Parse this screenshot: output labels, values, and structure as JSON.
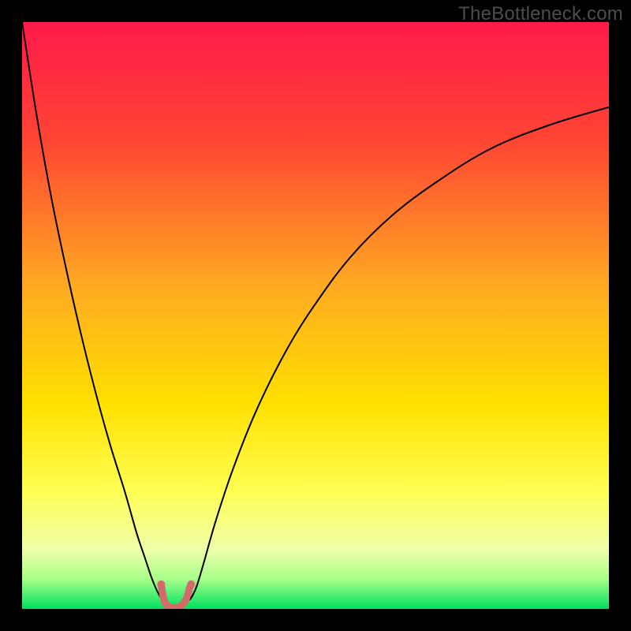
{
  "watermark": "TheBottleneck.com",
  "chart_data": {
    "type": "line",
    "title": "",
    "xlabel": "",
    "ylabel": "",
    "xlim": [
      0,
      100
    ],
    "ylim": [
      0,
      100
    ],
    "grid": false,
    "legend": false,
    "background_gradient": {
      "stops": [
        {
          "offset": 0.0,
          "color": "#ff1a4a"
        },
        {
          "offset": 0.2,
          "color": "#ff4433"
        },
        {
          "offset": 0.45,
          "color": "#ffaa22"
        },
        {
          "offset": 0.65,
          "color": "#ffe000"
        },
        {
          "offset": 0.8,
          "color": "#ffff55"
        },
        {
          "offset": 0.9,
          "color": "#eeffaa"
        },
        {
          "offset": 0.95,
          "color": "#a5ff88"
        },
        {
          "offset": 1.0,
          "color": "#00e060"
        }
      ]
    },
    "series": [
      {
        "name": "left-branch",
        "stroke": "#000000",
        "stroke_width": 2,
        "x": [
          0.0,
          2.5,
          5.0,
          7.5,
          10.0,
          12.5,
          15.0,
          17.5,
          19.5,
          21.0,
          22.0,
          22.8,
          23.3,
          23.7,
          24.0
        ],
        "y": [
          100.0,
          84.0,
          70.0,
          58.0,
          47.0,
          37.0,
          28.0,
          20.0,
          13.0,
          8.5,
          5.5,
          3.5,
          2.5,
          1.8,
          1.5
        ]
      },
      {
        "name": "right-branch",
        "stroke": "#000000",
        "stroke_width": 2,
        "x": [
          28.5,
          29.0,
          29.8,
          31.0,
          33.0,
          36.0,
          40.0,
          45.0,
          50.0,
          56.0,
          63.0,
          71.0,
          80.0,
          90.0,
          100.0
        ],
        "y": [
          1.5,
          2.2,
          4.0,
          8.0,
          15.0,
          24.0,
          34.0,
          44.0,
          52.0,
          60.0,
          67.0,
          73.0,
          78.5,
          82.5,
          85.5
        ]
      },
      {
        "name": "trough-marker",
        "stroke": "#d46a6a",
        "stroke_width": 9,
        "linecap": "round",
        "x": [
          23.7,
          24.0,
          24.3,
          24.8,
          25.5,
          26.3,
          27.0,
          27.7,
          28.2,
          28.5,
          28.8
        ],
        "y": [
          4.2,
          2.3,
          1.2,
          0.5,
          0.2,
          0.2,
          0.5,
          1.2,
          2.3,
          3.5,
          4.2
        ]
      }
    ]
  }
}
